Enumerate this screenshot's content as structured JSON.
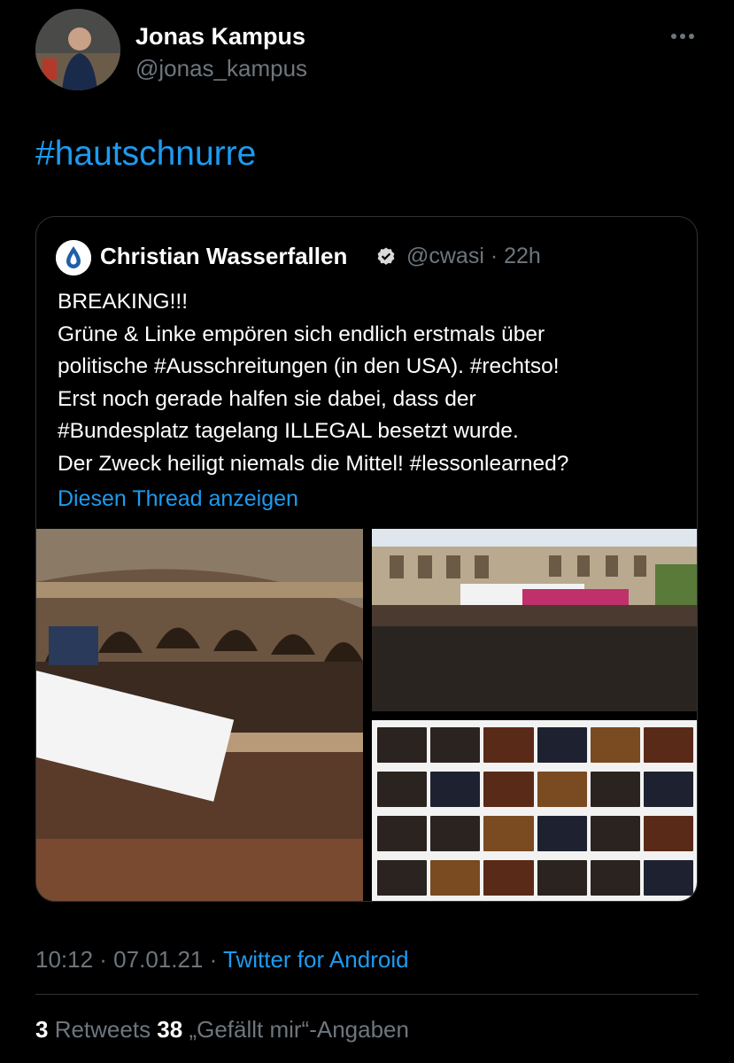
{
  "author": {
    "name": "Jonas Kampus",
    "handle": "@jonas_kampus"
  },
  "tweet": {
    "text": "#hautschnurre"
  },
  "quoted": {
    "name": "Christian Wasserfallen",
    "meta": "@cwasi · 22h",
    "lines": [
      "BREAKING!!!",
      "Grüne & Linke empören sich endlich erstmals über",
      "politische #Ausschreitungen (in den USA). #rechtso!",
      "Erst noch gerade halfen sie dabei, dass der",
      "#Bundesplatz tagelang ILLEGAL besetzt wurde.",
      "Der Zweck heiligt niemals die Mittel! #lessonlearned?"
    ],
    "show_thread": "Diesen Thread anzeigen"
  },
  "meta": {
    "timestamp": "10:12 · 07.01.21 · ",
    "client": "Twitter for Android"
  },
  "stats": {
    "retweets_count": "3",
    "retweets_label": " Retweets ",
    "likes_count": "38",
    "likes_label": " „Gefällt mir“-Angaben"
  },
  "colors": {
    "link": "#1d9bf0",
    "secondary": "#6e767d",
    "background": "#000000"
  },
  "icons": [
    "more-icon",
    "verified-icon",
    "water-drop-logo"
  ]
}
